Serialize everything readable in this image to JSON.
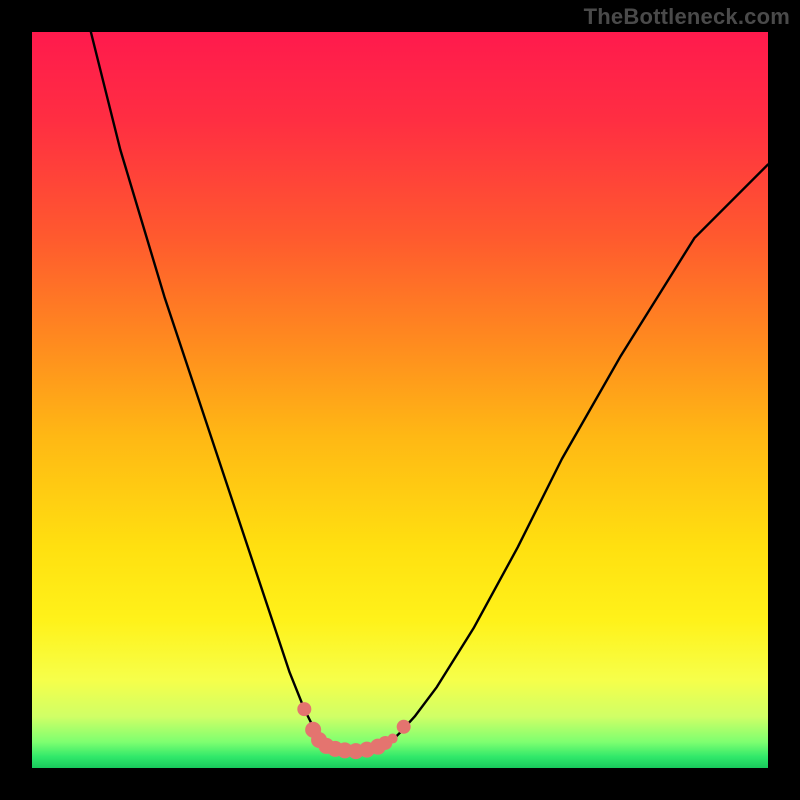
{
  "watermark": "TheBottleneck.com",
  "frame": {
    "outer_size": 800,
    "inner_margin": 32,
    "bg_outer": "#000000"
  },
  "gradient": {
    "stops": [
      {
        "offset": 0.0,
        "color": "#ff1a4d"
      },
      {
        "offset": 0.12,
        "color": "#ff2e42"
      },
      {
        "offset": 0.28,
        "color": "#ff5a2e"
      },
      {
        "offset": 0.42,
        "color": "#ff8a1f"
      },
      {
        "offset": 0.55,
        "color": "#ffb814"
      },
      {
        "offset": 0.7,
        "color": "#ffe010"
      },
      {
        "offset": 0.8,
        "color": "#fff21a"
      },
      {
        "offset": 0.88,
        "color": "#f6ff4a"
      },
      {
        "offset": 0.93,
        "color": "#d0ff66"
      },
      {
        "offset": 0.965,
        "color": "#7dff70"
      },
      {
        "offset": 0.985,
        "color": "#30e86a"
      },
      {
        "offset": 1.0,
        "color": "#18c95c"
      }
    ]
  },
  "chart_data": {
    "type": "line",
    "title": "",
    "xlabel": "",
    "ylabel": "",
    "xlim": [
      0,
      100
    ],
    "ylim": [
      0,
      100
    ],
    "series": [
      {
        "name": "bottleneck-curve",
        "x": [
          8,
          10,
          12,
          15,
          18,
          22,
          26,
          30,
          33,
          35,
          37,
          38.5,
          40,
          42,
          44,
          46,
          48,
          49,
          50,
          52,
          55,
          60,
          66,
          72,
          80,
          90,
          100
        ],
        "y": [
          100,
          92,
          84,
          74,
          64,
          52,
          40,
          28,
          19,
          13,
          8,
          5,
          3.2,
          2.4,
          2.2,
          2.4,
          3.0,
          3.8,
          4.8,
          7.0,
          11,
          19,
          30,
          42,
          56,
          72,
          82
        ],
        "stroke": "#000000",
        "stroke_width": 2.4
      }
    ],
    "markers": {
      "name": "trough-markers",
      "color": "#e4746f",
      "points": [
        {
          "x": 37.0,
          "y": 8.0,
          "r": 7
        },
        {
          "x": 38.2,
          "y": 5.2,
          "r": 8
        },
        {
          "x": 39.0,
          "y": 3.8,
          "r": 8
        },
        {
          "x": 40.0,
          "y": 3.0,
          "r": 8
        },
        {
          "x": 41.2,
          "y": 2.6,
          "r": 8
        },
        {
          "x": 42.5,
          "y": 2.4,
          "r": 8
        },
        {
          "x": 44.0,
          "y": 2.3,
          "r": 8
        },
        {
          "x": 45.5,
          "y": 2.5,
          "r": 8
        },
        {
          "x": 47.0,
          "y": 2.9,
          "r": 8
        },
        {
          "x": 48.0,
          "y": 3.4,
          "r": 7
        },
        {
          "x": 49.0,
          "y": 4.0,
          "r": 5
        },
        {
          "x": 50.5,
          "y": 5.6,
          "r": 7
        }
      ]
    }
  }
}
